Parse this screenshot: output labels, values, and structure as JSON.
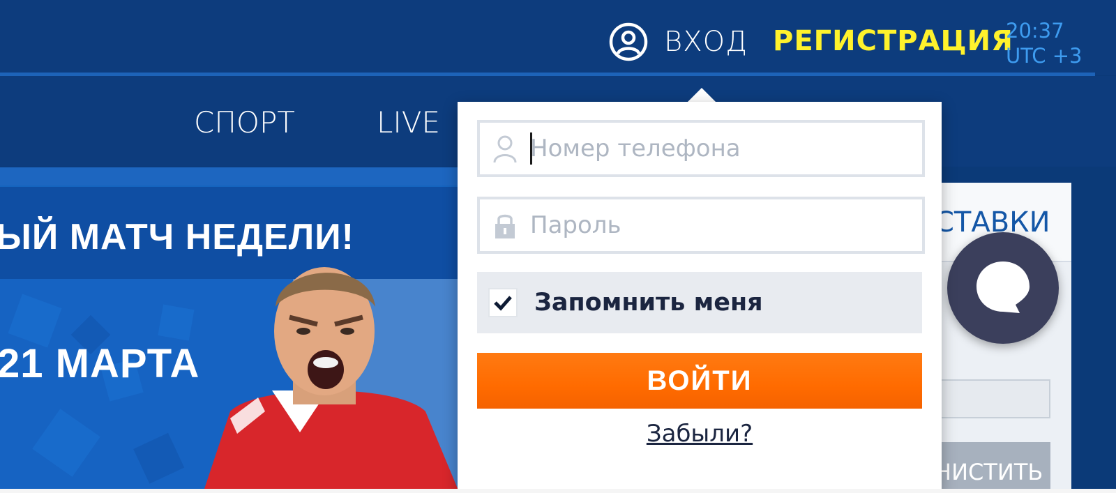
{
  "header": {
    "login_label": "ВХОД",
    "register_label": "РЕГИСТРАЦИЯ",
    "clock": {
      "time": "20:37",
      "timezone": "UTC +3"
    }
  },
  "nav": {
    "items": [
      {
        "label": "СПОРТ"
      },
      {
        "label": "LIVE"
      }
    ]
  },
  "banner": {
    "title": "ЫЙ МАТЧ НЕДЕЛИ!",
    "date": "21 МАРТА"
  },
  "bets_panel": {
    "title": "СТАВКИ",
    "clear_label": "НИСТИТЬ"
  },
  "login_form": {
    "phone_placeholder": "Номер телефона",
    "phone_value": "",
    "password_placeholder": "Пароль",
    "password_value": "",
    "remember_label": "Запомнить меня",
    "remember_checked": true,
    "submit_label": "ВОЙТИ",
    "forgot_label": "Забыли?"
  },
  "colors": {
    "header_bg": "#0d3c7d",
    "accent_yellow": "#fff22c",
    "clock_blue": "#3e9cf0",
    "submit_orange": "#ff6b00",
    "chat_bubble": "#3b3f5c"
  },
  "icons": [
    "user-circle-icon",
    "user-icon",
    "lock-icon",
    "checkmark-icon",
    "chat-icon"
  ]
}
